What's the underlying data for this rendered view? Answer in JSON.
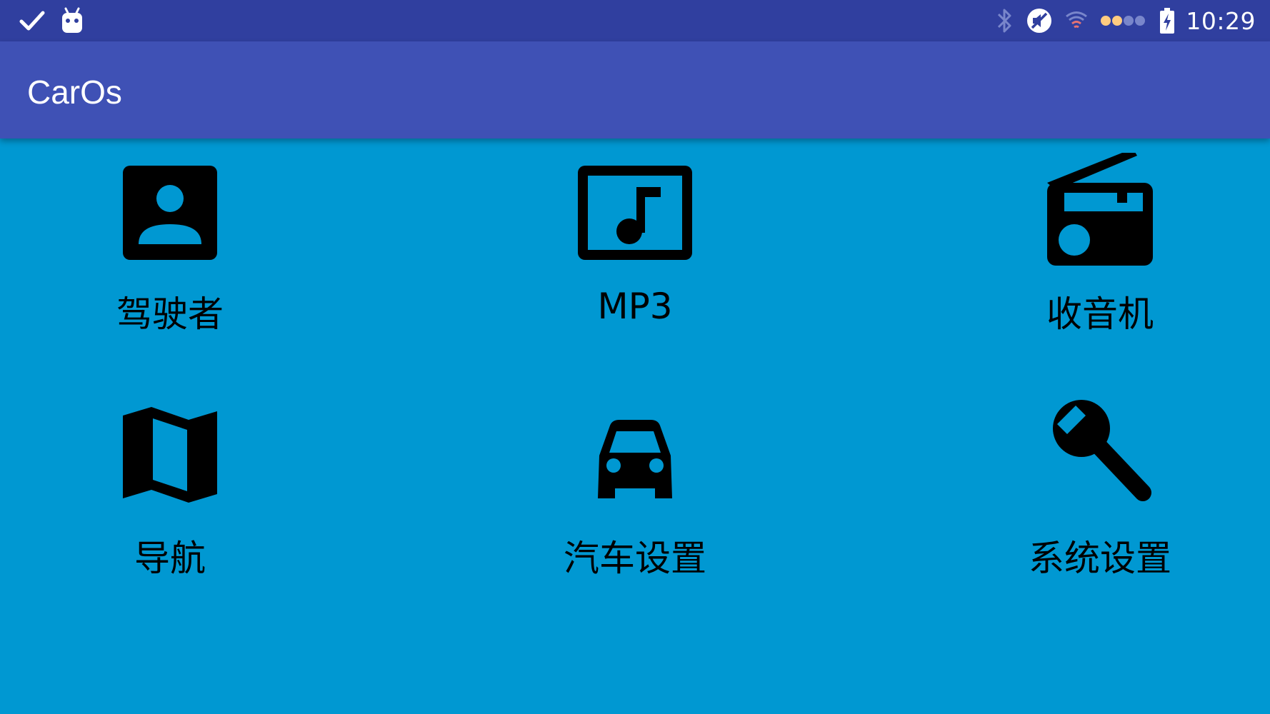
{
  "status_bar": {
    "time": "10:29",
    "left_icons": [
      "check-icon",
      "android-icon"
    ],
    "right_icons": [
      "bluetooth-icon",
      "mute-icon",
      "wifi-icon",
      "signal-dots-icon",
      "battery-charging-icon"
    ]
  },
  "app_bar": {
    "title": "CarOs"
  },
  "tiles": [
    {
      "label": "驾驶者",
      "icon": "contact-icon"
    },
    {
      "label": "MP3",
      "icon": "music-icon"
    },
    {
      "label": "收音机",
      "icon": "radio-icon"
    },
    {
      "label": "导航",
      "icon": "map-icon"
    },
    {
      "label": "汽车设置",
      "icon": "car-icon"
    },
    {
      "label": "系统设置",
      "icon": "wrench-icon"
    }
  ],
  "colors": {
    "status_bar": "#303f9f",
    "app_bar": "#3f51b5",
    "content_background": "#0098d2",
    "icon_and_label": "#000000"
  }
}
